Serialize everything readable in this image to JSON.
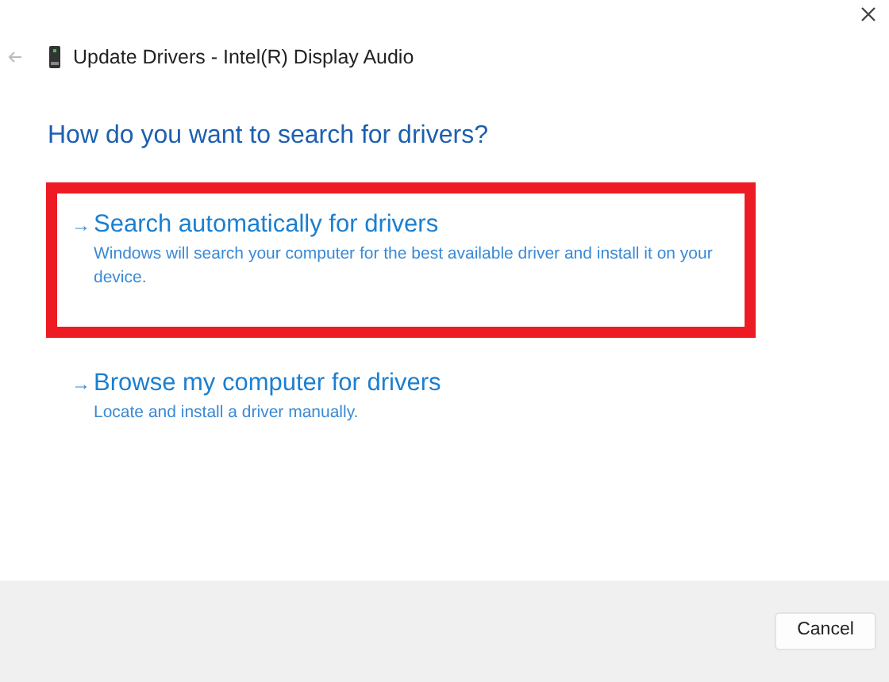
{
  "window": {
    "title": "Update Drivers - Intel(R) Display Audio"
  },
  "heading": "How do you want to search for drivers?",
  "options": [
    {
      "arrow": "→",
      "title": "Search automatically for drivers",
      "description": "Windows will search your computer for the best available driver and install it on your device.",
      "highlighted": true
    },
    {
      "arrow": "→",
      "title": "Browse my computer for drivers",
      "description": "Locate and install a driver manually.",
      "highlighted": false
    }
  ],
  "buttons": [
    "Cancel"
  ]
}
